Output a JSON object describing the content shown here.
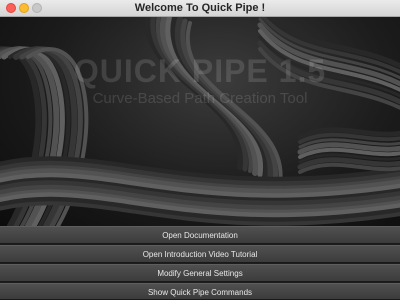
{
  "window": {
    "title": "Welcome To Quick Pipe !"
  },
  "hero": {
    "logo_title": "QUICK PIPE 1.5",
    "logo_subtitle": "Curve-Based Path Creation Tool"
  },
  "buttons": [
    "Open Documentation",
    "Open Introduction Video Tutorial",
    "Modify General Settings",
    "Show Quick Pipe Commands"
  ]
}
